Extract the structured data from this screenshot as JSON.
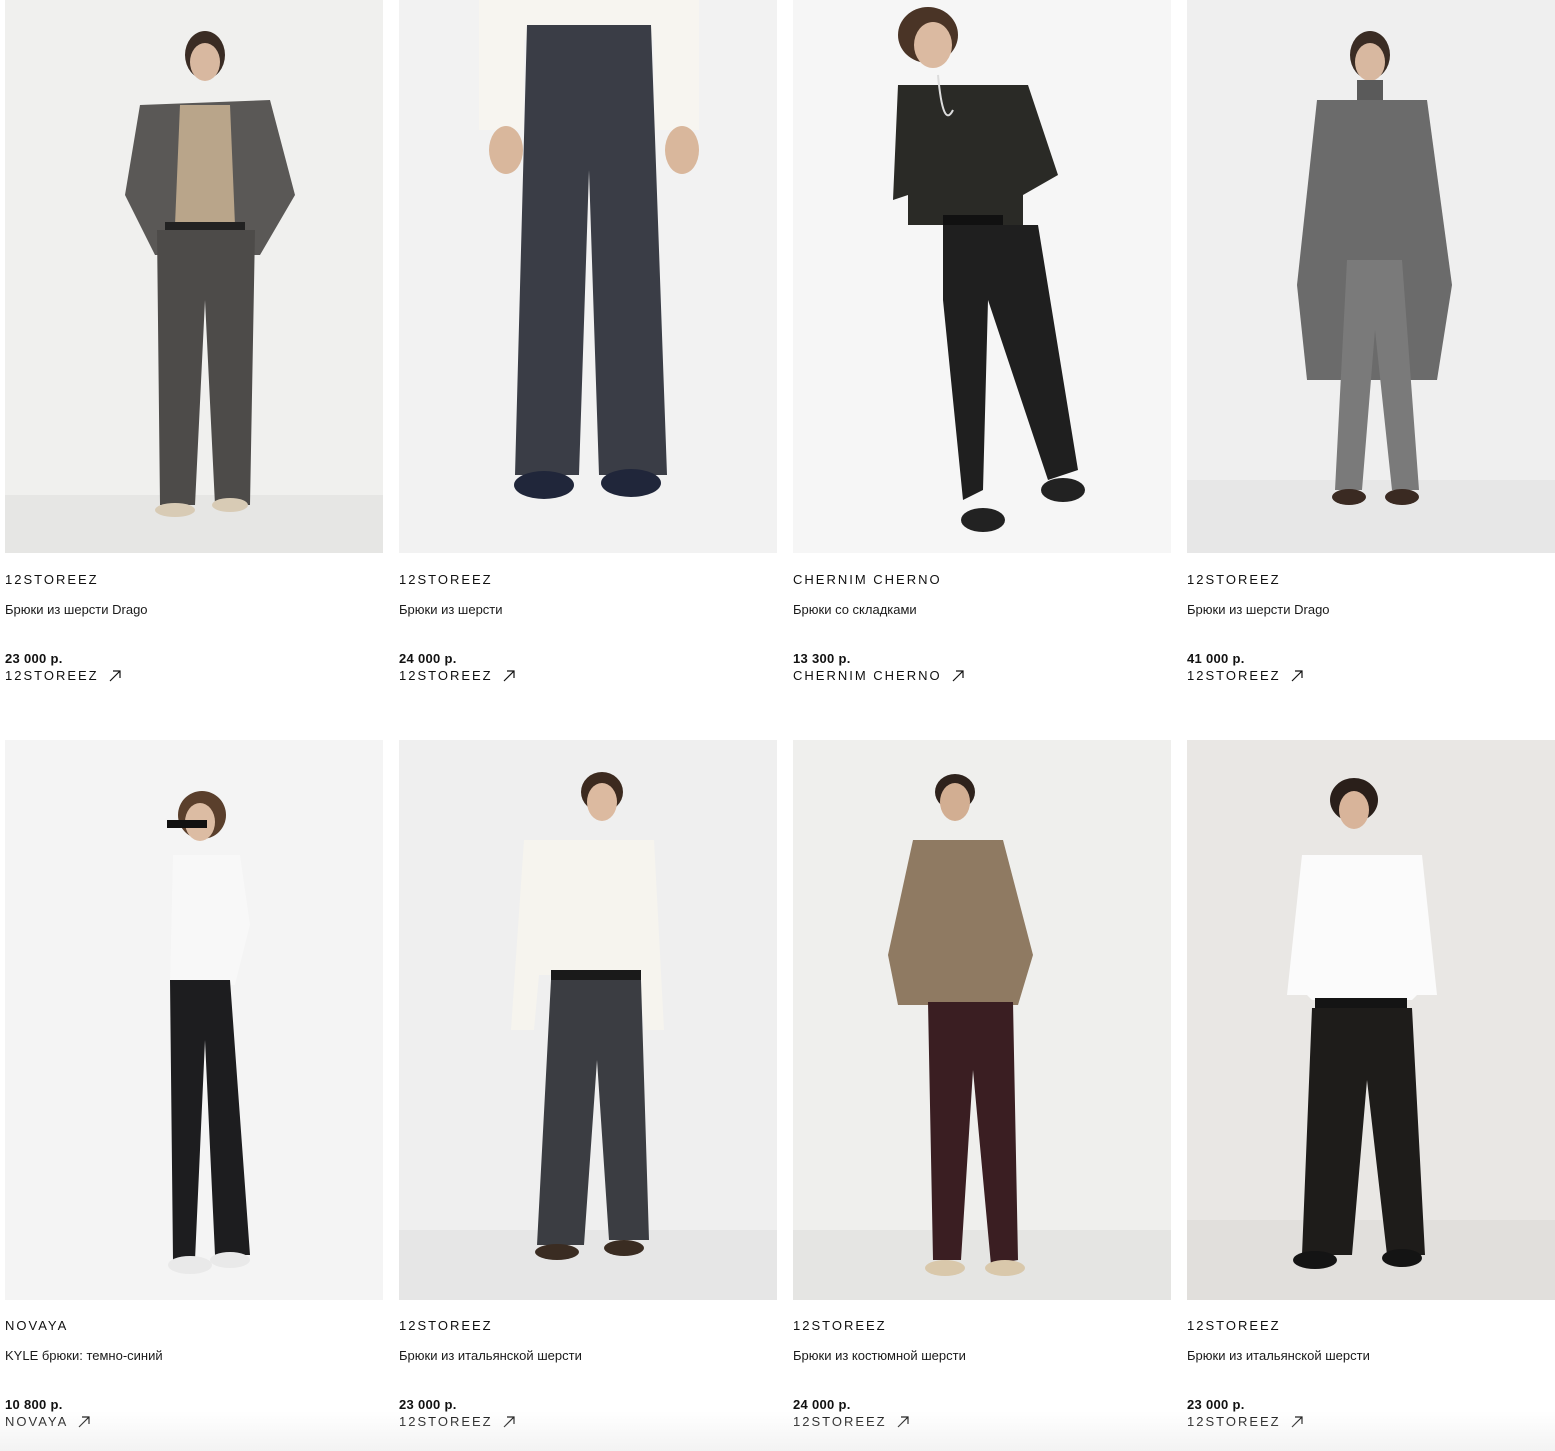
{
  "products": [
    {
      "brand": "12STOREEZ",
      "title": "Брюки из шерсти Drago",
      "price": "23 000 р.",
      "shop": "12STOREEZ",
      "image": "model-grey-suit-jacket"
    },
    {
      "brand": "12STOREEZ",
      "title": "Брюки из шерсти",
      "price": "24 000 р.",
      "shop": "12STOREEZ",
      "image": "navy-wide-trousers"
    },
    {
      "brand": "CHERNIM CHERNO",
      "title": "Брюки со складками",
      "price": "13 300 р.",
      "shop": "CHERNIM CHERNO",
      "image": "model-mesh-tee-black-trousers"
    },
    {
      "brand": "12STOREEZ",
      "title": "Брюки из шерсти Drago",
      "price": "41 000 р.",
      "shop": "12STOREEZ",
      "image": "model-grey-coat"
    },
    {
      "brand": "NOVAYA",
      "title": "KYLE брюки: темно-синий",
      "price": "10 800 р.",
      "shop": "NOVAYA",
      "image": "model-white-tee-black-trousers"
    },
    {
      "brand": "12STOREEZ",
      "title": "Брюки из итальянской шерсти",
      "price": "23 000 р.",
      "shop": "12STOREEZ",
      "image": "model-white-shirt-charcoal-trousers"
    },
    {
      "brand": "12STOREEZ",
      "title": "Брюки из костюмной шерсти",
      "price": "24 000 р.",
      "shop": "12STOREEZ",
      "image": "model-beige-polo-burgundy-trousers"
    },
    {
      "brand": "12STOREEZ",
      "title": "Брюки из итальянской шерсти",
      "price": "23 000 р.",
      "shop": "12STOREEZ",
      "image": "model-white-shirt-black-trousers"
    }
  ],
  "icons": {
    "external_link": "arrow-up-right-icon"
  },
  "colors": {
    "text": "#111111",
    "photo_bg": "#f1f1f1"
  }
}
